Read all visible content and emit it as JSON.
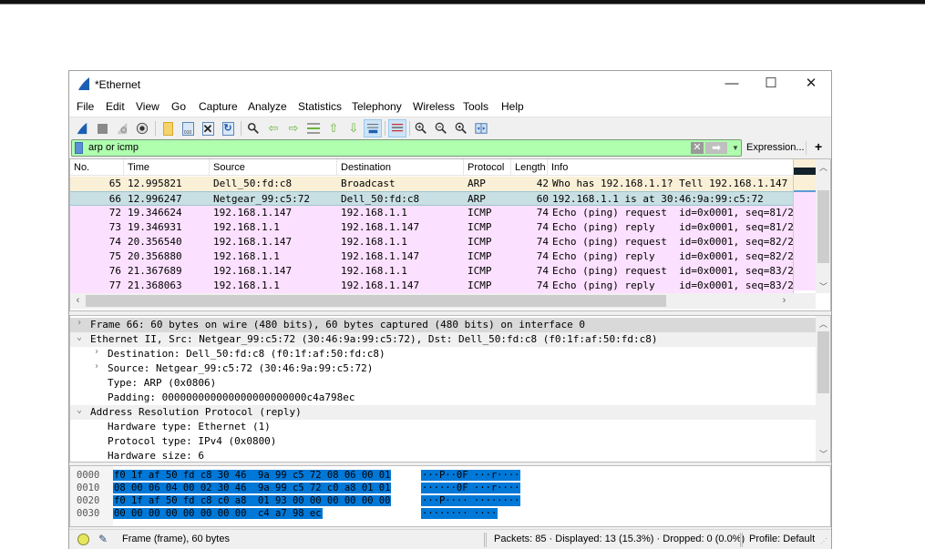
{
  "window": {
    "title": "*Ethernet",
    "controls": {
      "minimize": "—",
      "maximize": "☐",
      "close": "✕"
    }
  },
  "menu": [
    "File",
    "Edit",
    "View",
    "Go",
    "Capture",
    "Analyze",
    "Statistics",
    "Telephony",
    "Wireless",
    "Tools",
    "Help"
  ],
  "toolbar": {
    "icons": [
      "start-capture-icon",
      "stop-capture-icon",
      "restart-capture-icon",
      "capture-options-icon",
      "open-file-icon",
      "save-file-icon",
      "close-file-icon",
      "reload-file-icon",
      "find-packet-icon",
      "go-back-icon",
      "go-forward-icon",
      "go-to-packet-icon",
      "go-first-packet-icon",
      "go-last-packet-icon",
      "autoscroll-icon",
      "colorize-icon",
      "zoom-in-icon",
      "zoom-out-icon",
      "zoom-normal-icon",
      "resize-columns-icon"
    ]
  },
  "filter": {
    "value": "arp or icmp",
    "expression_label": "Expression...",
    "add_label": "+",
    "colors": {
      "valid": "#afffaf"
    }
  },
  "packet_list": {
    "columns": [
      "No.",
      "Time",
      "Source",
      "Destination",
      "Protocol",
      "Length",
      "Info"
    ],
    "rows": [
      {
        "no": "65",
        "time": "12.995821",
        "source": "Dell_50:fd:c8",
        "destination": "Broadcast",
        "protocol": "ARP",
        "length": "42",
        "info": "Who has 192.168.1.1? Tell 192.168.1.147",
        "color": "#faf0d7"
      },
      {
        "no": "66",
        "time": "12.996247",
        "source": "Netgear_99:c5:72",
        "destination": "Dell_50:fd:c8",
        "protocol": "ARP",
        "length": "60",
        "info": "192.168.1.1 is at 30:46:9a:99:c5:72",
        "color": "#c8dfe3",
        "selected": true
      },
      {
        "no": "72",
        "time": "19.346624",
        "source": "192.168.1.147",
        "destination": "192.168.1.1",
        "protocol": "ICMP",
        "length": "74",
        "info": "Echo (ping) request  id=0x0001, seq=81/2",
        "color": "#fce0ff"
      },
      {
        "no": "73",
        "time": "19.346931",
        "source": "192.168.1.1",
        "destination": "192.168.1.147",
        "protocol": "ICMP",
        "length": "74",
        "info": "Echo (ping) reply    id=0x0001, seq=81/2",
        "color": "#fce0ff"
      },
      {
        "no": "74",
        "time": "20.356540",
        "source": "192.168.1.147",
        "destination": "192.168.1.1",
        "protocol": "ICMP",
        "length": "74",
        "info": "Echo (ping) request  id=0x0001, seq=82/2",
        "color": "#fce0ff"
      },
      {
        "no": "75",
        "time": "20.356880",
        "source": "192.168.1.1",
        "destination": "192.168.1.147",
        "protocol": "ICMP",
        "length": "74",
        "info": "Echo (ping) reply    id=0x0001, seq=82/2",
        "color": "#fce0ff"
      },
      {
        "no": "76",
        "time": "21.367689",
        "source": "192.168.1.147",
        "destination": "192.168.1.1",
        "protocol": "ICMP",
        "length": "74",
        "info": "Echo (ping) request  id=0x0001, seq=83/2",
        "color": "#fce0ff"
      },
      {
        "no": "77",
        "time": "21.368063",
        "source": "192.168.1.1",
        "destination": "192.168.1.147",
        "protocol": "ICMP",
        "length": "74",
        "info": "Echo (ping) reply    id=0x0001, seq=83/2",
        "color": "#fce0ff"
      }
    ]
  },
  "details": {
    "rows": [
      {
        "level": 0,
        "expander": "›",
        "text": "Frame 66: 60 bytes on wire (480 bits), 60 bytes captured (480 bits) on interface 0",
        "highlight": "selected"
      },
      {
        "level": 0,
        "expander": "⌄",
        "text": "Ethernet II, Src: Netgear_99:c5:72 (30:46:9a:99:c5:72), Dst: Dell_50:fd:c8 (f0:1f:af:50:fd:c8)",
        "highlight": "section"
      },
      {
        "level": 1,
        "expander": "›",
        "text": "Destination: Dell_50:fd:c8 (f0:1f:af:50:fd:c8)"
      },
      {
        "level": 1,
        "expander": "›",
        "text": "Source: Netgear_99:c5:72 (30:46:9a:99:c5:72)"
      },
      {
        "level": 1,
        "expander": "",
        "text": "Type: ARP (0x0806)"
      },
      {
        "level": 1,
        "expander": "",
        "text": "Padding: 000000000000000000000000c4a798ec"
      },
      {
        "level": 0,
        "expander": "⌄",
        "text": "Address Resolution Protocol (reply)",
        "highlight": "section"
      },
      {
        "level": 1,
        "expander": "",
        "text": "Hardware type: Ethernet (1)"
      },
      {
        "level": 1,
        "expander": "",
        "text": "Protocol type: IPv4 (0x0800)"
      },
      {
        "level": 1,
        "expander": "",
        "text": "Hardware size: 6"
      }
    ]
  },
  "bytes": {
    "rows": [
      {
        "offset": "0000",
        "hex": "f0 1f af 50 fd c8 30 46  9a 99 c5 72 08 06 00 01",
        "ascii": "···P··0F ···r····"
      },
      {
        "offset": "0010",
        "hex": "08 00 06 04 00 02 30 46  9a 99 c5 72 c0 a8 01 01",
        "ascii": "······0F ···r····"
      },
      {
        "offset": "0020",
        "hex": "f0 1f af 50 fd c8 c0 a8  01 93 00 00 00 00 00 00",
        "ascii": "···P···· ········"
      },
      {
        "offset": "0030",
        "hex": "00 00 00 00 00 00 00 00  c4 a7 98 ec",
        "ascii": "········ ····"
      }
    ],
    "highlight_color": "#0078d7"
  },
  "status": {
    "field_info": "Frame (frame), 60 bytes",
    "packets": "Packets: 85 · Displayed: 13 (15.3%) · Dropped: 0 (0.0%)",
    "profile": "Profile: Default"
  }
}
